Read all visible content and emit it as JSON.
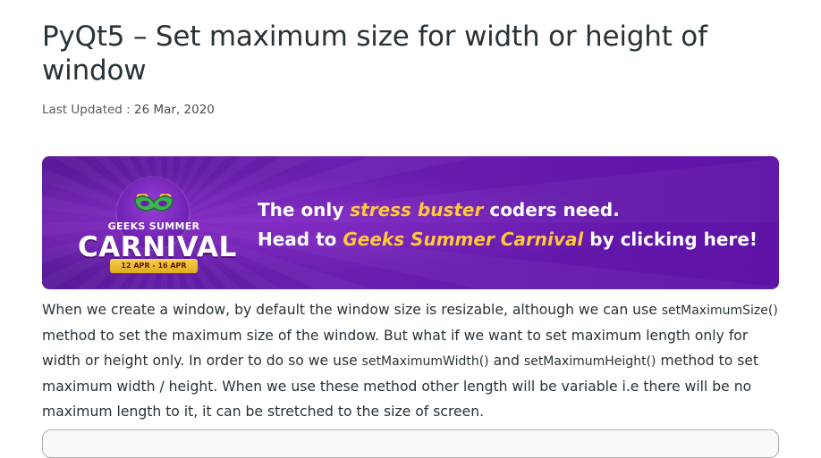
{
  "article": {
    "title": "PyQt5 – Set maximum size for width or height of window",
    "last_updated_label": "Last Updated :",
    "last_updated_date": "26 Mar, 2020"
  },
  "banner": {
    "logo_line1": "GEEKS SUMMER",
    "logo_line2": "CARNIVAL",
    "logo_dates": "12 APR - 16 APR",
    "tagline_part1": "The only ",
    "tagline_hl1": "stress buster",
    "tagline_part2": " coders need.",
    "tagline_part3": "Head to ",
    "tagline_hl2": "Geeks Summer Carnival",
    "tagline_part4": " by clicking here!",
    "colors": {
      "background": "#6a1fb0",
      "highlight": "#ffc83a",
      "text": "#ffffff"
    }
  },
  "body": {
    "p1": "When we create a window, by default the window size is resizable, although we can use ",
    "code1": "setMaximumSize()",
    "p2": " method to set the maximum size of the window. But what if we want to set maximum length only for width or height only. In order to do so we use ",
    "code2": "setMaximumWidth()",
    "p3": " and ",
    "code3": "setMaximumHeight()",
    "p4": " method to set maximum width / height. When we use these method other length will be variable i.e there will be no maximum length to it, it can be stretched to the size of screen."
  }
}
